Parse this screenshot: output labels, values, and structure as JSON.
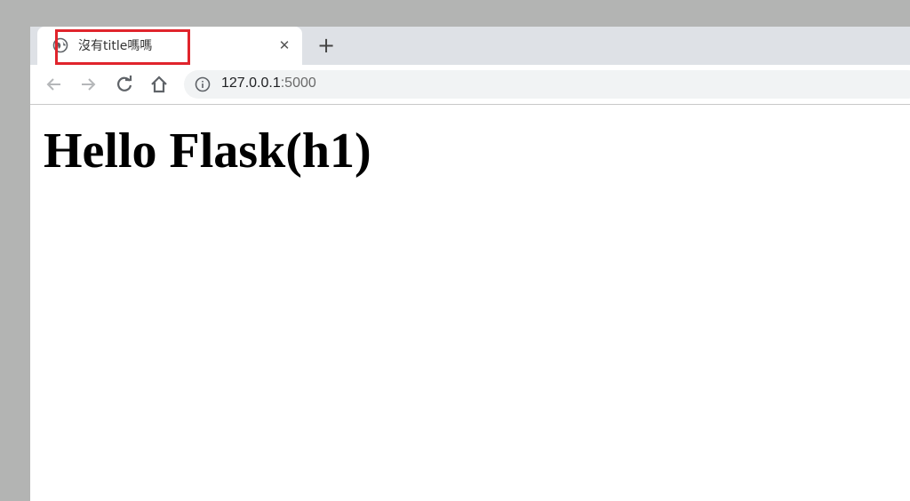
{
  "tab": {
    "title": "沒有title嗎嗎",
    "close_icon": "close-icon",
    "favicon": "globe-icon"
  },
  "new_tab": {
    "label": "+"
  },
  "toolbar": {
    "back_icon": "back-arrow-icon",
    "forward_icon": "forward-arrow-icon",
    "reload_icon": "reload-icon",
    "home_icon": "home-icon"
  },
  "omnibox": {
    "host": "127.0.0.1",
    "port": ":5000",
    "info_icon": "info-icon"
  },
  "page": {
    "heading": "Hello Flask(h1)"
  },
  "colors": {
    "highlight": "#e0242c",
    "tabstrip": "#dee1e6",
    "omnibox_bg": "#f1f3f4"
  }
}
